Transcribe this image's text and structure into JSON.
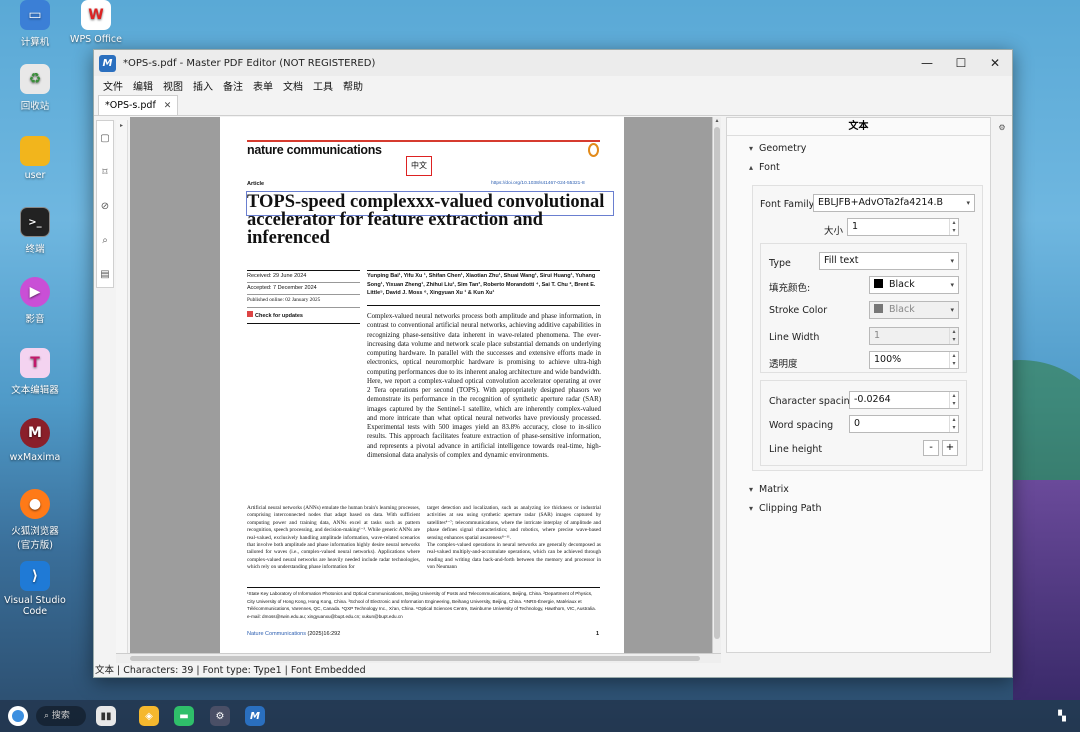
{
  "desktop": {
    "icons": [
      {
        "label": "计算机",
        "name": "computer-icon"
      },
      {
        "label": "WPS Office",
        "name": "wps-office-icon"
      },
      {
        "label": "回收站",
        "name": "recycle-bin-icon"
      },
      {
        "label": "user",
        "name": "user-folder-icon"
      },
      {
        "label": "终端",
        "name": "terminal-icon"
      },
      {
        "label": "影音",
        "name": "media-player-icon"
      },
      {
        "label": "文本编辑器",
        "name": "text-editor-icon"
      },
      {
        "label": "wxMaxima",
        "name": "wxmaxima-icon"
      },
      {
        "label": "火狐浏览器\n(官方版)",
        "name": "firefox-icon"
      },
      {
        "label": "Visual Studio\nCode",
        "name": "vscode-icon"
      }
    ]
  },
  "window": {
    "title": "*OPS-s.pdf - Master PDF Editor (NOT REGISTERED)",
    "menu": [
      "文件",
      "编辑",
      "视图",
      "插入",
      "备注",
      "表单",
      "文档",
      "工具",
      "帮助"
    ],
    "tab_label": "*OPS-s.pdf"
  },
  "document": {
    "journal": "nature communications",
    "stamp": "中文",
    "article_label": "Article",
    "doi": "https://doi.org/10.1038/s41467-024-55321-8",
    "title_line1": "TOPS-speed complexxx-valued convolutional",
    "title_line2": "accelerator for feature extraction and",
    "title_line3": "inferenced",
    "received": "Received: 29 June 2024",
    "accepted": "Accepted: 7 December 2024",
    "published": "Published online: 02 January 2025",
    "check_updates": "Check for updates",
    "authors": "Yunping Bai¹, Yifu Xu ¹, Shifan Chen¹, Xiaotian Zhu¹, Shuai Wang¹, Sirui Huang¹, Yuhang Song¹, Yixuan Zheng¹, Zhihui Liu¹, Sim Tan³, Roberto Morandotti ⁴, Sai T. Chu ², Brent E. Little⁵, David J. Moss ⁶, Xingyuan Xu ¹ & Kun Xu¹",
    "abstract": "Complex-valued neural networks process both amplitude and phase information, in contrast to conventional artificial neural networks, achieving additive capabilities in recognizing phase-sensitive data inherent in wave-related phenomena. The ever-increasing data volume and network scale place substantial demands on underlying computing hardware. In parallel with the successes and extensive efforts made in electronics, optical neuromorphic hardware is promising to achieve ultra-high computing performances due to its inherent analog architecture and wide bandwidth. Here, we report a complex-valued optical convolution accelerator operating at over 2 Tera operations per second (TOPS). With appropriately designed phasors we demonstrate its performance in the recognition of synthetic aperture radar (SAR) images captured by the Sentinel-1 satellite, which are inherently complex-valued and more intricate than what optical neural networks have previously processed. Experimental tests with 500 images yield an 83.8% accuracy, close to in-silico results. This approach facilitates feature extraction of phase-sensitive information, and represents a pivotal advance in artificial intelligence towards real-time, high-dimensional data analysis of complex and dynamic environments.",
    "body_col1": "Artificial neural networks (ANNs) emulate the human brain's learning processes, comprising interconnected nodes that adapt based on data. With sufficient computing power and training data, ANNs excel at tasks such as pattern recognition, speech processing, and decision-making¹⁻³. While generic ANNs are real-valued, exclusively handling amplitude information, wave-related scenarios that involve both amplitude and phase information highly desire neural networks tailored for waves (i.e., complex-valued neural networks). Applications where complex-valued neural networks are heavily needed include radar technologies, which rely on understanding phase information for",
    "body_col2": "target detection and localization, such as analyzing ice thickness or industrial activities at sea using synthetic aperture radar (SAR) images captured by satellites⁴⁻⁷; telecommunications, where the intricate interplay of amplitude and phase defines signal characteristics; and robotics, where precise wave-based sensing enhances spatial awareness⁸⁻¹¹.\n    The complex-valued operations in neural networks are generally decomposed as real-valued multiply-and-accumulate operations, which can be achieved through reading and writing data back-and-forth between the memory and processor in von Neumann",
    "affiliations": "¹State Key Laboratory of Information Photonics and Optical Communications, Beijing University of Posts and Telecommunications, Beijing, China. ²Department of Physics, City University of Hong Kong, Hong Kong, China. ³School of Electronic and Information Engineering, Beihang University, Beijing, China. ⁴INRS-Énergie, Matériaux et Télécommunications, Varennes, QC, Canada. ⁵QXP Technology Inc., Xi'an, China. ⁶Optical Sciences Centre, Swinburne University of Technology, Hawthorn, VIC, Australia. e-mail: dmoss@swin.edu.au; xingyuanxu@bupt.edu.cn; xukun@bupt.edu.cn",
    "footer_journal": "Nature Communications",
    "footer_cite": "(2025)16:292",
    "page_number": "1"
  },
  "panel": {
    "header": "文本",
    "geometry_label": "Geometry",
    "font_label": "Font",
    "font_family_label": "Font Family",
    "font_family_value": "EBLJFB+AdvOTa2fa4214.B",
    "size_label": "大小",
    "size_value": "1",
    "type_label": "Type",
    "type_value": "Fill text",
    "fill_color_label": "填充颜色:",
    "fill_color_value": "Black",
    "stroke_color_label": "Stroke Color",
    "stroke_color_value": "Black",
    "line_width_label": "Line Width",
    "line_width_value": "1",
    "opacity_label": "透明度",
    "opacity_value": "100%",
    "char_spacing_label": "Character spacing",
    "char_spacing_value": "-0.0264",
    "word_spacing_label": "Word spacing",
    "word_spacing_value": "0",
    "line_height_label": "Line height",
    "minus": "-",
    "plus": "+",
    "matrix_label": "Matrix",
    "clipping_label": "Clipping Path"
  },
  "status": {
    "text": "文本 | Characters: 39 | Font type: Type1 | Font Embedded"
  },
  "taskbar": {
    "search_placeholder": "搜索"
  }
}
